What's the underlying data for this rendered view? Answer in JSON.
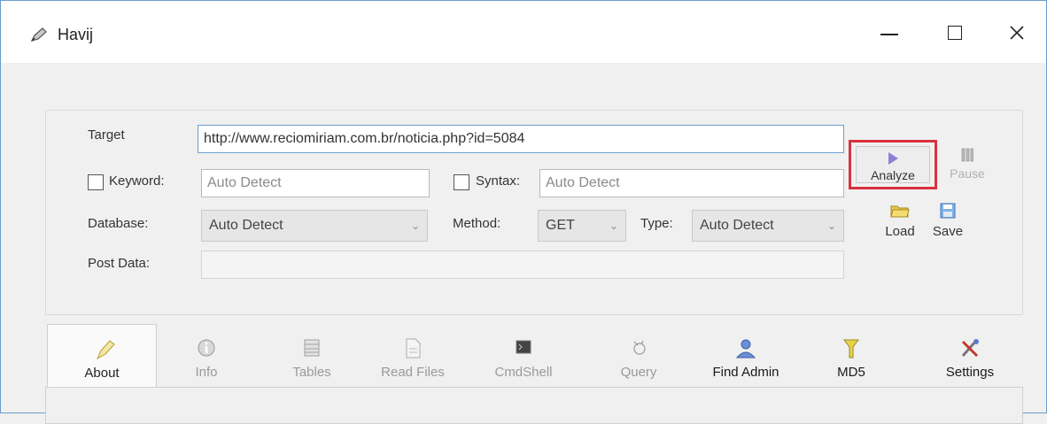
{
  "window": {
    "title": "Havij",
    "icon": "pen-icon"
  },
  "form": {
    "target_label": "Target",
    "target_value": "http://www.reciomiriam.com.br/noticia.php?id=5084",
    "keyword_label": "Keyword:",
    "keyword_placeholder": "Auto Detect",
    "syntax_label": "Syntax:",
    "syntax_placeholder": "Auto Detect",
    "database_label": "Database:",
    "database_value": "Auto Detect",
    "method_label": "Method:",
    "method_value": "GET",
    "type_label": "Type:",
    "type_value": "Auto Detect",
    "post_data_label": "Post Data:",
    "post_data_value": ""
  },
  "actions": {
    "analyze_label": "Analyze",
    "pause_label": "Pause",
    "load_label": "Load",
    "save_label": "Save",
    "highlight_color": "#d9323f"
  },
  "tabs": [
    {
      "label": "About",
      "icon": "pen-icon",
      "state": "selected"
    },
    {
      "label": "Info",
      "icon": "info-icon",
      "state": "disabled"
    },
    {
      "label": "Tables",
      "icon": "table-icon",
      "state": "disabled"
    },
    {
      "label": "Read Files",
      "icon": "file-icon",
      "state": "disabled"
    },
    {
      "label": "CmdShell",
      "icon": "terminal-icon",
      "state": "disabled"
    },
    {
      "label": "Query",
      "icon": "query-icon",
      "state": "disabled"
    },
    {
      "label": "Find Admin",
      "icon": "admin-icon",
      "state": "enabled"
    },
    {
      "label": "MD5",
      "icon": "key-icon",
      "state": "enabled"
    },
    {
      "label": "Settings",
      "icon": "settings-icon",
      "state": "enabled"
    }
  ]
}
